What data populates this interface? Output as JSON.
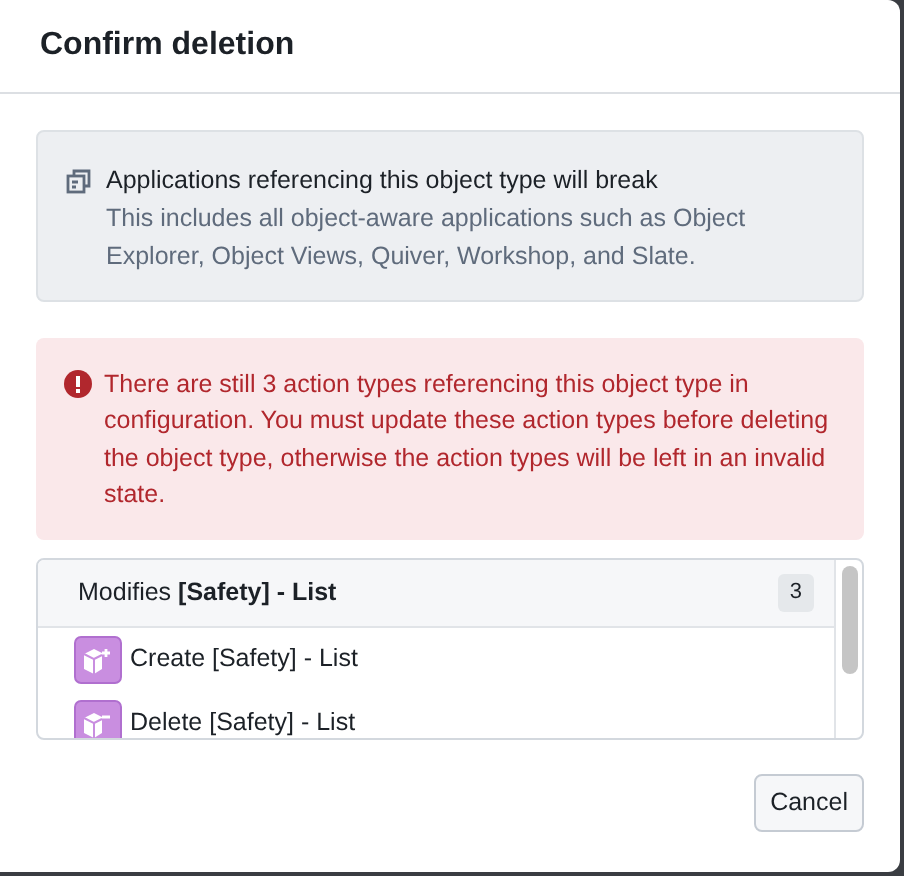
{
  "dialog": {
    "title": "Confirm deletion"
  },
  "info_callout": {
    "title": "Applications referencing this object type will break",
    "description": "This includes all object-aware applications such as Object Explorer, Object Views, Quiver, Workshop, and Slate."
  },
  "error_callout": {
    "message": "There are still 3 action types referencing this object type in configuration. You must update these action types before deleting the object type, otherwise the action types will be left in an invalid state."
  },
  "reference_list": {
    "header": "Modifies **[Safety] - List**",
    "count": "3",
    "items": [
      {
        "kind": "create",
        "label": "Create [Safety] - List"
      },
      {
        "kind": "delete",
        "label": "Delete [Safety] - List"
      }
    ]
  },
  "buttons": [
    "Cancel"
  ]
}
